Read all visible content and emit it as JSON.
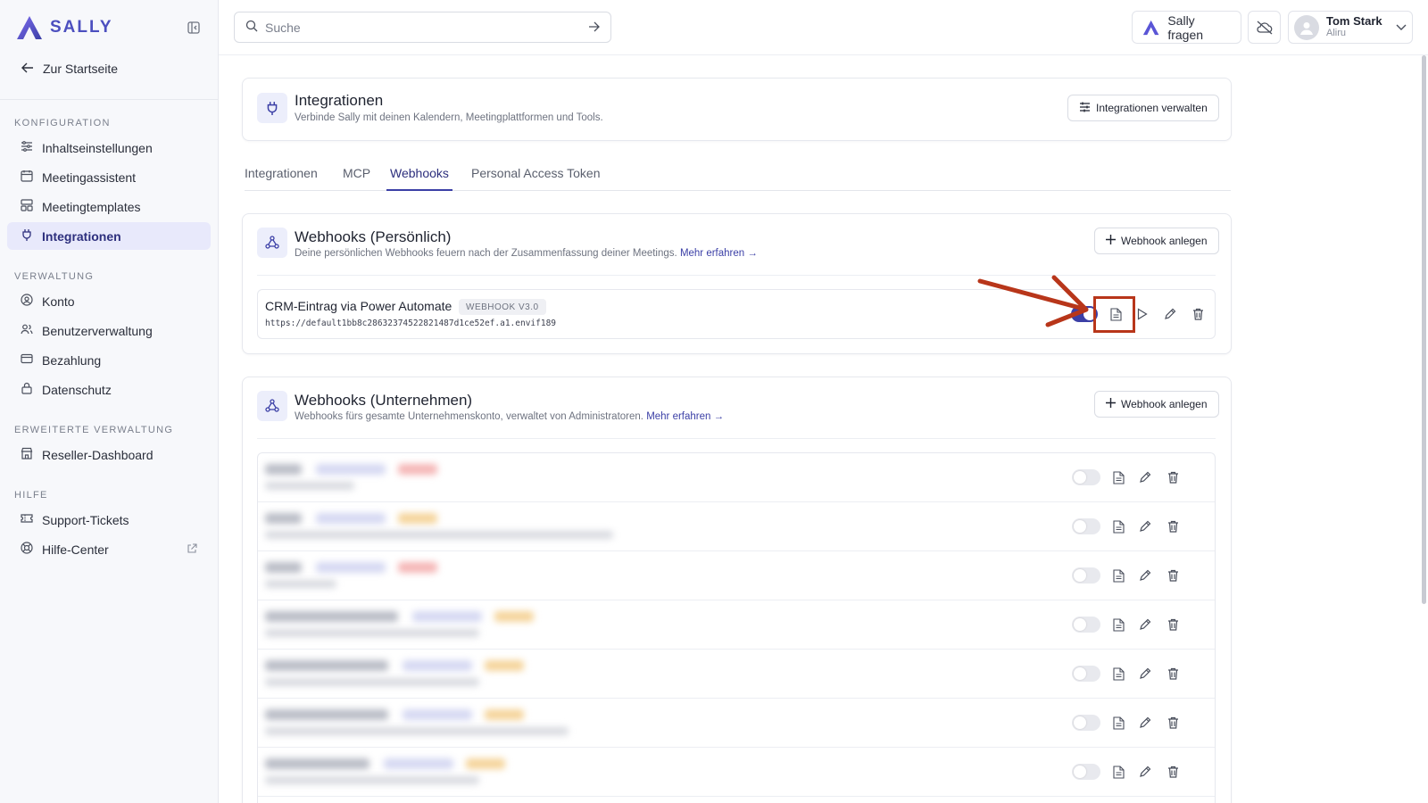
{
  "brand": {
    "name": "SALLY",
    "color": "#4c4fbf"
  },
  "sidebar": {
    "back_label": "Zur Startseite",
    "sections": [
      {
        "title": "KONFIGURATION",
        "items": [
          {
            "label": "Inhaltseinstellungen",
            "icon": "sliders-icon"
          },
          {
            "label": "Meetingassistent",
            "icon": "calendar-icon"
          },
          {
            "label": "Meetingtemplates",
            "icon": "template-icon"
          },
          {
            "label": "Integrationen",
            "icon": "plug-icon",
            "active": true
          }
        ]
      },
      {
        "title": "VERWALTUNG",
        "items": [
          {
            "label": "Konto",
            "icon": "user-circle-icon"
          },
          {
            "label": "Benutzerverwaltung",
            "icon": "users-icon"
          },
          {
            "label": "Bezahlung",
            "icon": "credit-card-icon"
          },
          {
            "label": "Datenschutz",
            "icon": "lock-icon"
          }
        ]
      },
      {
        "title": "ERWEITERTE VERWALTUNG",
        "items": [
          {
            "label": "Reseller-Dashboard",
            "icon": "store-icon"
          }
        ]
      },
      {
        "title": "HILFE",
        "items": [
          {
            "label": "Support-Tickets",
            "icon": "ticket-icon"
          },
          {
            "label": "Hilfe-Center",
            "icon": "lifebuoy-icon",
            "external": true
          }
        ]
      }
    ]
  },
  "topbar": {
    "search_placeholder": "Suche",
    "ask_label": "Sally fragen",
    "user": {
      "name": "Tom Stark",
      "org": "Aliru"
    }
  },
  "header_card": {
    "title": "Integrationen",
    "subtitle": "Verbinde Sally mit deinen Kalendern, Meetingplattformen und Tools.",
    "manage_label": "Integrationen verwalten"
  },
  "tabs": [
    {
      "label": "Integrationen"
    },
    {
      "label": "MCP"
    },
    {
      "label": "Webhooks",
      "active": true
    },
    {
      "label": "Personal Access Token"
    }
  ],
  "personal": {
    "title": "Webhooks (Persönlich)",
    "subtitle": "Deine persönlichen Webhooks feuern nach der Zusammenfassung deiner Meetings.",
    "more": "Mehr erfahren →",
    "add_label": "Webhook anlegen",
    "webhook": {
      "name": "CRM-Eintrag via Power Automate",
      "badge": "WEBHOOK V3.0",
      "url": "https://default1bb8c28632374522821487d1ce52ef.a1.envif189",
      "enabled": true
    }
  },
  "company": {
    "title": "Webhooks (Unternehmen)",
    "subtitle": "Webhooks fürs gesamte Unternehmenskonto, verwaltet von Administratoren.",
    "more": "Mehr erfahren →",
    "add_label": "Webhook anlegen",
    "rows": [
      {
        "name_w": 0.02,
        "badge_color": "#f5b5b5"
      },
      {
        "name_w": 0.02,
        "badge_color": "#f5d49a"
      },
      {
        "name_w": 0.02,
        "badge_color": "#f5b5b5"
      },
      {
        "name_w": 0.12,
        "badge_color": "#f5d49a"
      },
      {
        "name_w": 0.11,
        "badge_color": "#f5d49a"
      },
      {
        "name_w": 0.11,
        "badge_color": "#f5d49a"
      },
      {
        "name_w": 0.09,
        "badge_color": "#f5d49a"
      }
    ]
  },
  "annotation": {
    "arrow_color": "#b8361a"
  }
}
